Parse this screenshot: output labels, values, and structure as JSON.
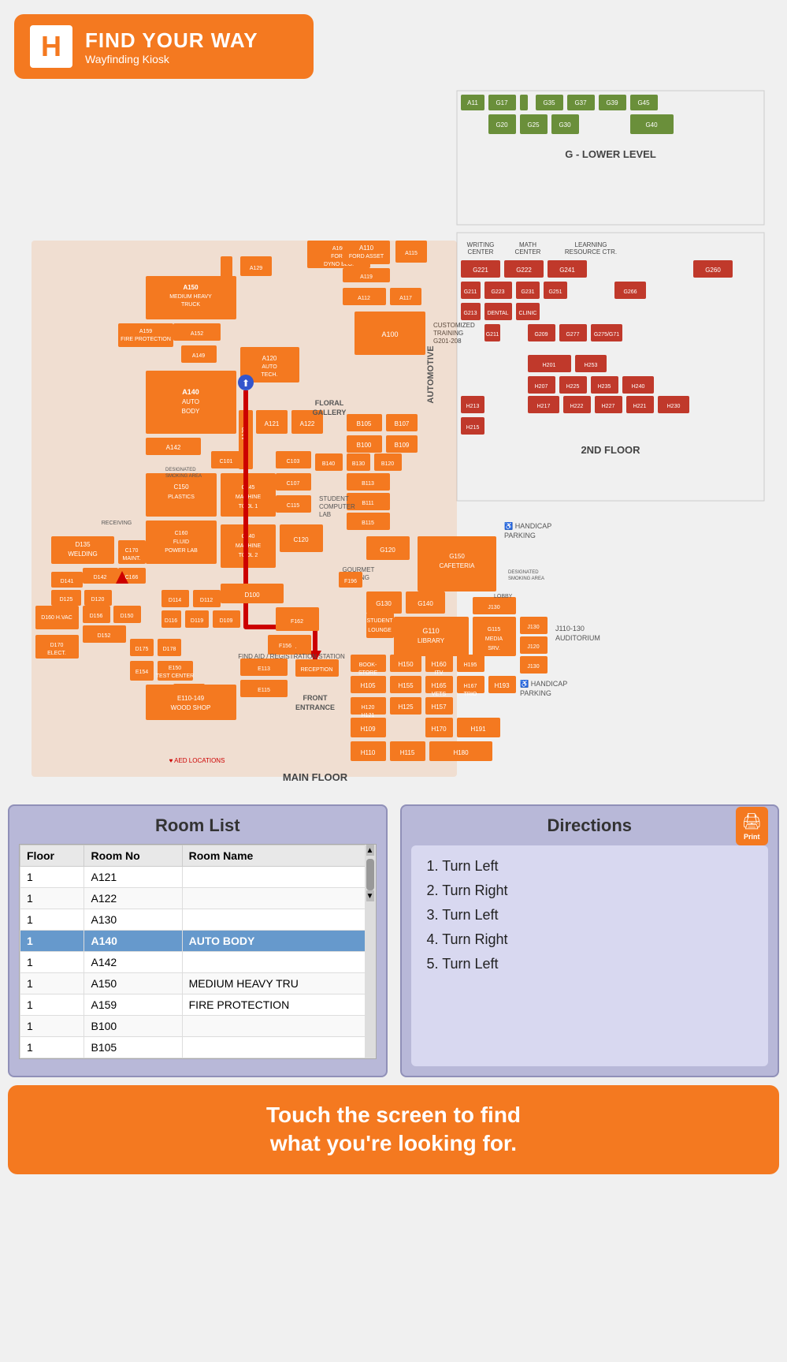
{
  "header": {
    "logo_text": "H",
    "title": "FIND YOUR WAY",
    "subtitle": "Wayfinding Kiosk"
  },
  "map": {
    "main_floor_label": "MAIN FLOOR",
    "second_floor_label": "2ND FLOOR",
    "g_lower_label": "G - LOWER LEVEL",
    "aed_label": "AED LOCATIONS"
  },
  "room_list": {
    "title": "Room List",
    "columns": [
      "Floor",
      "Room No",
      "Room Name"
    ],
    "rows": [
      {
        "floor": "1",
        "room_no": "A121",
        "room_name": "",
        "selected": false
      },
      {
        "floor": "1",
        "room_no": "A122",
        "room_name": "",
        "selected": false
      },
      {
        "floor": "1",
        "room_no": "A130",
        "room_name": "",
        "selected": false
      },
      {
        "floor": "1",
        "room_no": "A140",
        "room_name": "AUTO BODY",
        "selected": true
      },
      {
        "floor": "1",
        "room_no": "A142",
        "room_name": "",
        "selected": false
      },
      {
        "floor": "1",
        "room_no": "A150",
        "room_name": "MEDIUM HEAVY TRU",
        "selected": false
      },
      {
        "floor": "1",
        "room_no": "A159",
        "room_name": "FIRE PROTECTION",
        "selected": false
      },
      {
        "floor": "1",
        "room_no": "B100",
        "room_name": "",
        "selected": false
      },
      {
        "floor": "1",
        "room_no": "B105",
        "room_name": "",
        "selected": false
      }
    ]
  },
  "directions": {
    "title": "Directions",
    "print_label": "Print",
    "steps": [
      "1. Turn Left",
      "2. Turn Right",
      "3. Turn Left",
      "4. Turn Right",
      "5. Turn Left"
    ]
  },
  "touch_cta": {
    "line1": "Touch the screen to find",
    "line2": "what you're looking for."
  }
}
